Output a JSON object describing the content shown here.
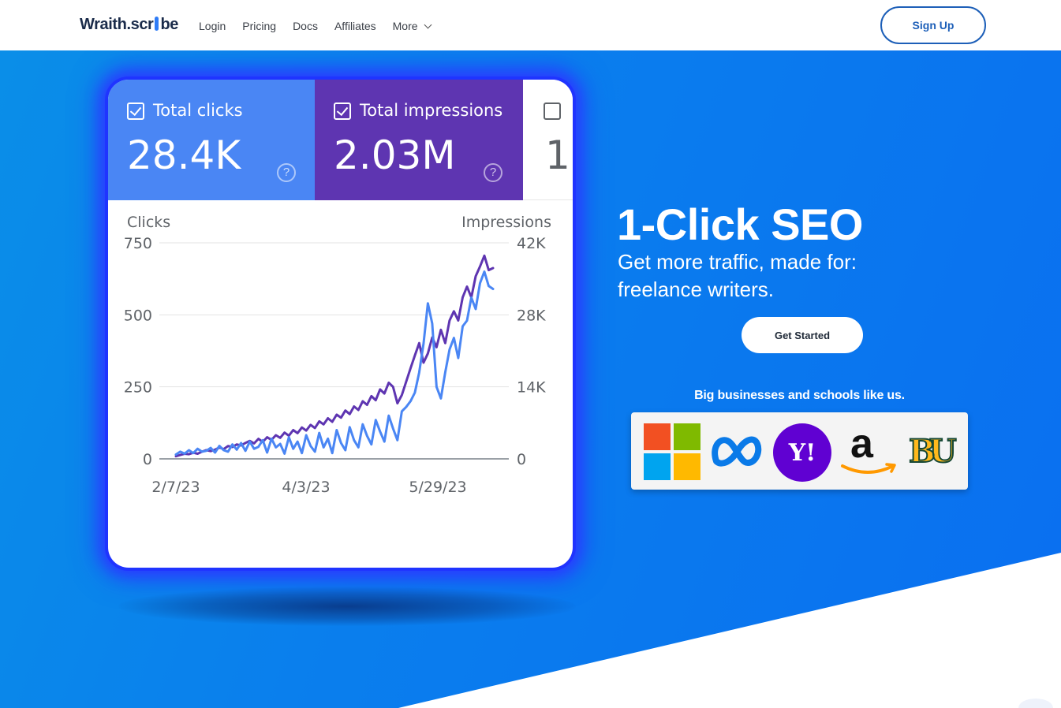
{
  "nav": {
    "brand_left": "Wr",
    "brand_mid": "aith.scr",
    "brand_right": "be",
    "links": [
      "Login",
      "Pricing",
      "Docs",
      "Affiliates"
    ],
    "more_label": "More",
    "signup_label": "Sign Up"
  },
  "hero": {
    "headline": "1-Click SEO",
    "subline_1": "Get more traffic, made for:",
    "subline_2": "freelance writers.",
    "cta_label": "Get Started",
    "trust_text": "Big businesses and schools like us.",
    "logos": [
      "microsoft-logo",
      "meta-logo",
      "yahoo-logo",
      "amazon-logo",
      "baylor-logo"
    ],
    "yahoo_text": "Y!",
    "baylor_text": "BU",
    "amazon_text": "a"
  },
  "card": {
    "tiles": [
      {
        "label": "Total clicks",
        "value": "28.4K",
        "checked": true,
        "color": "#4a86f4"
      },
      {
        "label": "Total impressions",
        "value": "2.03M",
        "checked": true,
        "color": "#5e35b1"
      },
      {
        "label": "",
        "value": "1.",
        "checked": false,
        "color": "#ffffff"
      }
    ],
    "help_glyph": "?"
  },
  "chart_data": {
    "type": "line",
    "ylabel_left": "Clicks",
    "ylabel_right": "Impressions",
    "left_ticks": [
      "750",
      "500",
      "250",
      "0"
    ],
    "right_ticks": [
      "42K",
      "28K",
      "14K",
      "0"
    ],
    "x_ticks": [
      "2/7/23",
      "4/3/23",
      "5/29/23"
    ],
    "ylim_left": [
      0,
      750
    ],
    "ylim_right": [
      0,
      42000
    ],
    "grid": true,
    "series": [
      {
        "axis": "right",
        "color": "#5e35b1",
        "values": [
          500,
          750,
          1000,
          900,
          1200,
          1000,
          1400,
          1700,
          1500,
          1800,
          2200,
          1900,
          2500,
          2300,
          2800,
          2600,
          3100,
          3500,
          3000,
          3900,
          3300,
          4200,
          3700,
          4600,
          4100,
          5100,
          4500,
          5600,
          5000,
          6100,
          5500,
          6600,
          6000,
          7300,
          6700,
          7900,
          7200,
          8600,
          8000,
          9400,
          8700,
          10200,
          9500,
          11200,
          10500,
          12200,
          11400,
          13500,
          12700,
          14800,
          14000,
          10800,
          12400,
          15000,
          17600,
          20100,
          22500,
          18700,
          20500,
          23600,
          21700,
          25100,
          22500,
          26900,
          28700,
          26900,
          31400,
          33500,
          31400,
          35500,
          37400,
          39500,
          36700,
          37100
        ]
      },
      {
        "axis": "left",
        "color": "#4a86f4",
        "values": [
          15,
          25,
          18,
          30,
          20,
          35,
          25,
          28,
          38,
          22,
          45,
          30,
          25,
          50,
          32,
          55,
          28,
          60,
          35,
          42,
          65,
          22,
          70,
          40,
          52,
          18,
          75,
          35,
          60,
          20,
          82,
          45,
          25,
          90,
          40,
          70,
          20,
          100,
          55,
          30,
          110,
          65,
          40,
          120,
          80,
          50,
          135,
          95,
          60,
          150,
          105,
          65,
          165,
          180,
          200,
          230,
          300,
          400,
          540,
          470,
          250,
          210,
          300,
          380,
          420,
          350,
          460,
          480,
          560,
          520,
          610,
          650,
          600,
          590
        ]
      }
    ]
  }
}
